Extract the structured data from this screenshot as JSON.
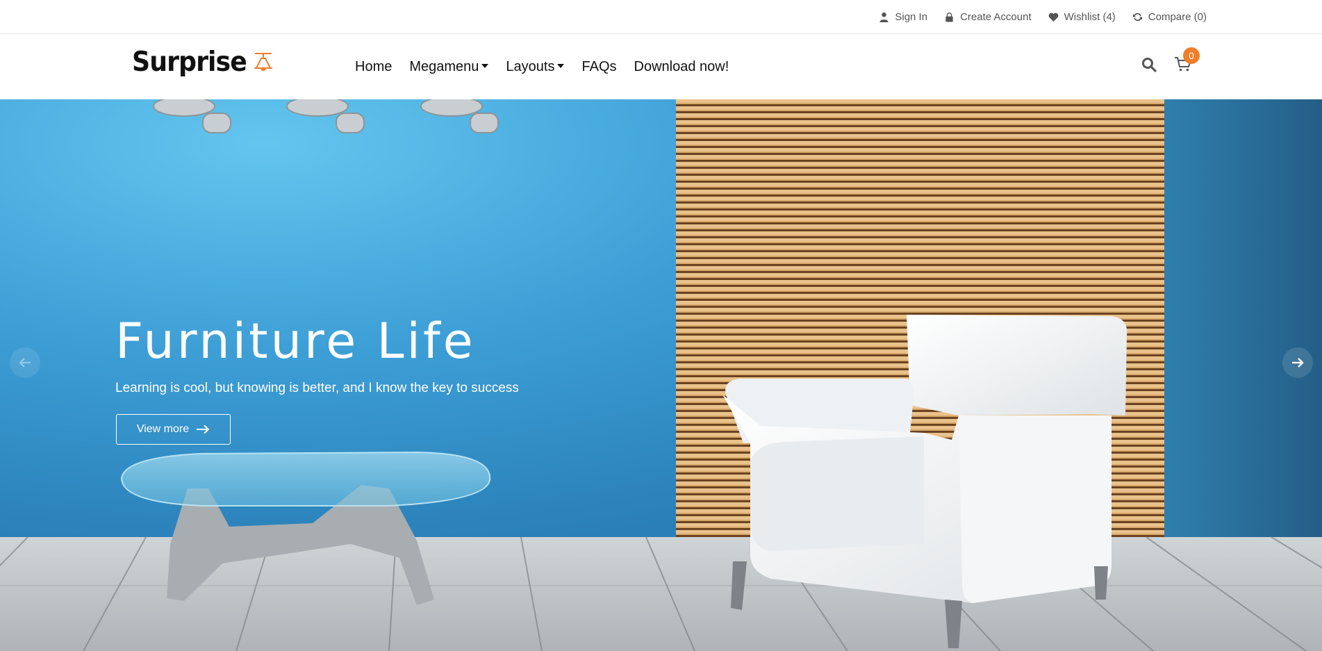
{
  "topbar": {
    "sign_in": "Sign In",
    "create_account": "Create Account",
    "wishlist": "Wishlist (4)",
    "compare": "Compare (0)"
  },
  "header": {
    "logo_text": "Surprise",
    "nav": {
      "home": "Home",
      "megamenu": "Megamenu",
      "layouts": "Layouts",
      "faqs": "FAQs",
      "download": "Download now!"
    },
    "cart_count": "0"
  },
  "hero": {
    "title": "Furniture Life",
    "subtitle": "Learning is cool, but knowing is better, and I know the key to success",
    "button_label": "View more"
  },
  "colors": {
    "accent": "#ef7d2a",
    "wall_blue": "#3a9ad4",
    "text_dark": "#111111",
    "text_muted": "#555555"
  },
  "icons": [
    "user-icon",
    "lock-icon",
    "heart-icon",
    "refresh-icon",
    "lamp-icon",
    "search-icon",
    "cart-icon",
    "arrow-right-icon",
    "arrow-left-icon"
  ]
}
